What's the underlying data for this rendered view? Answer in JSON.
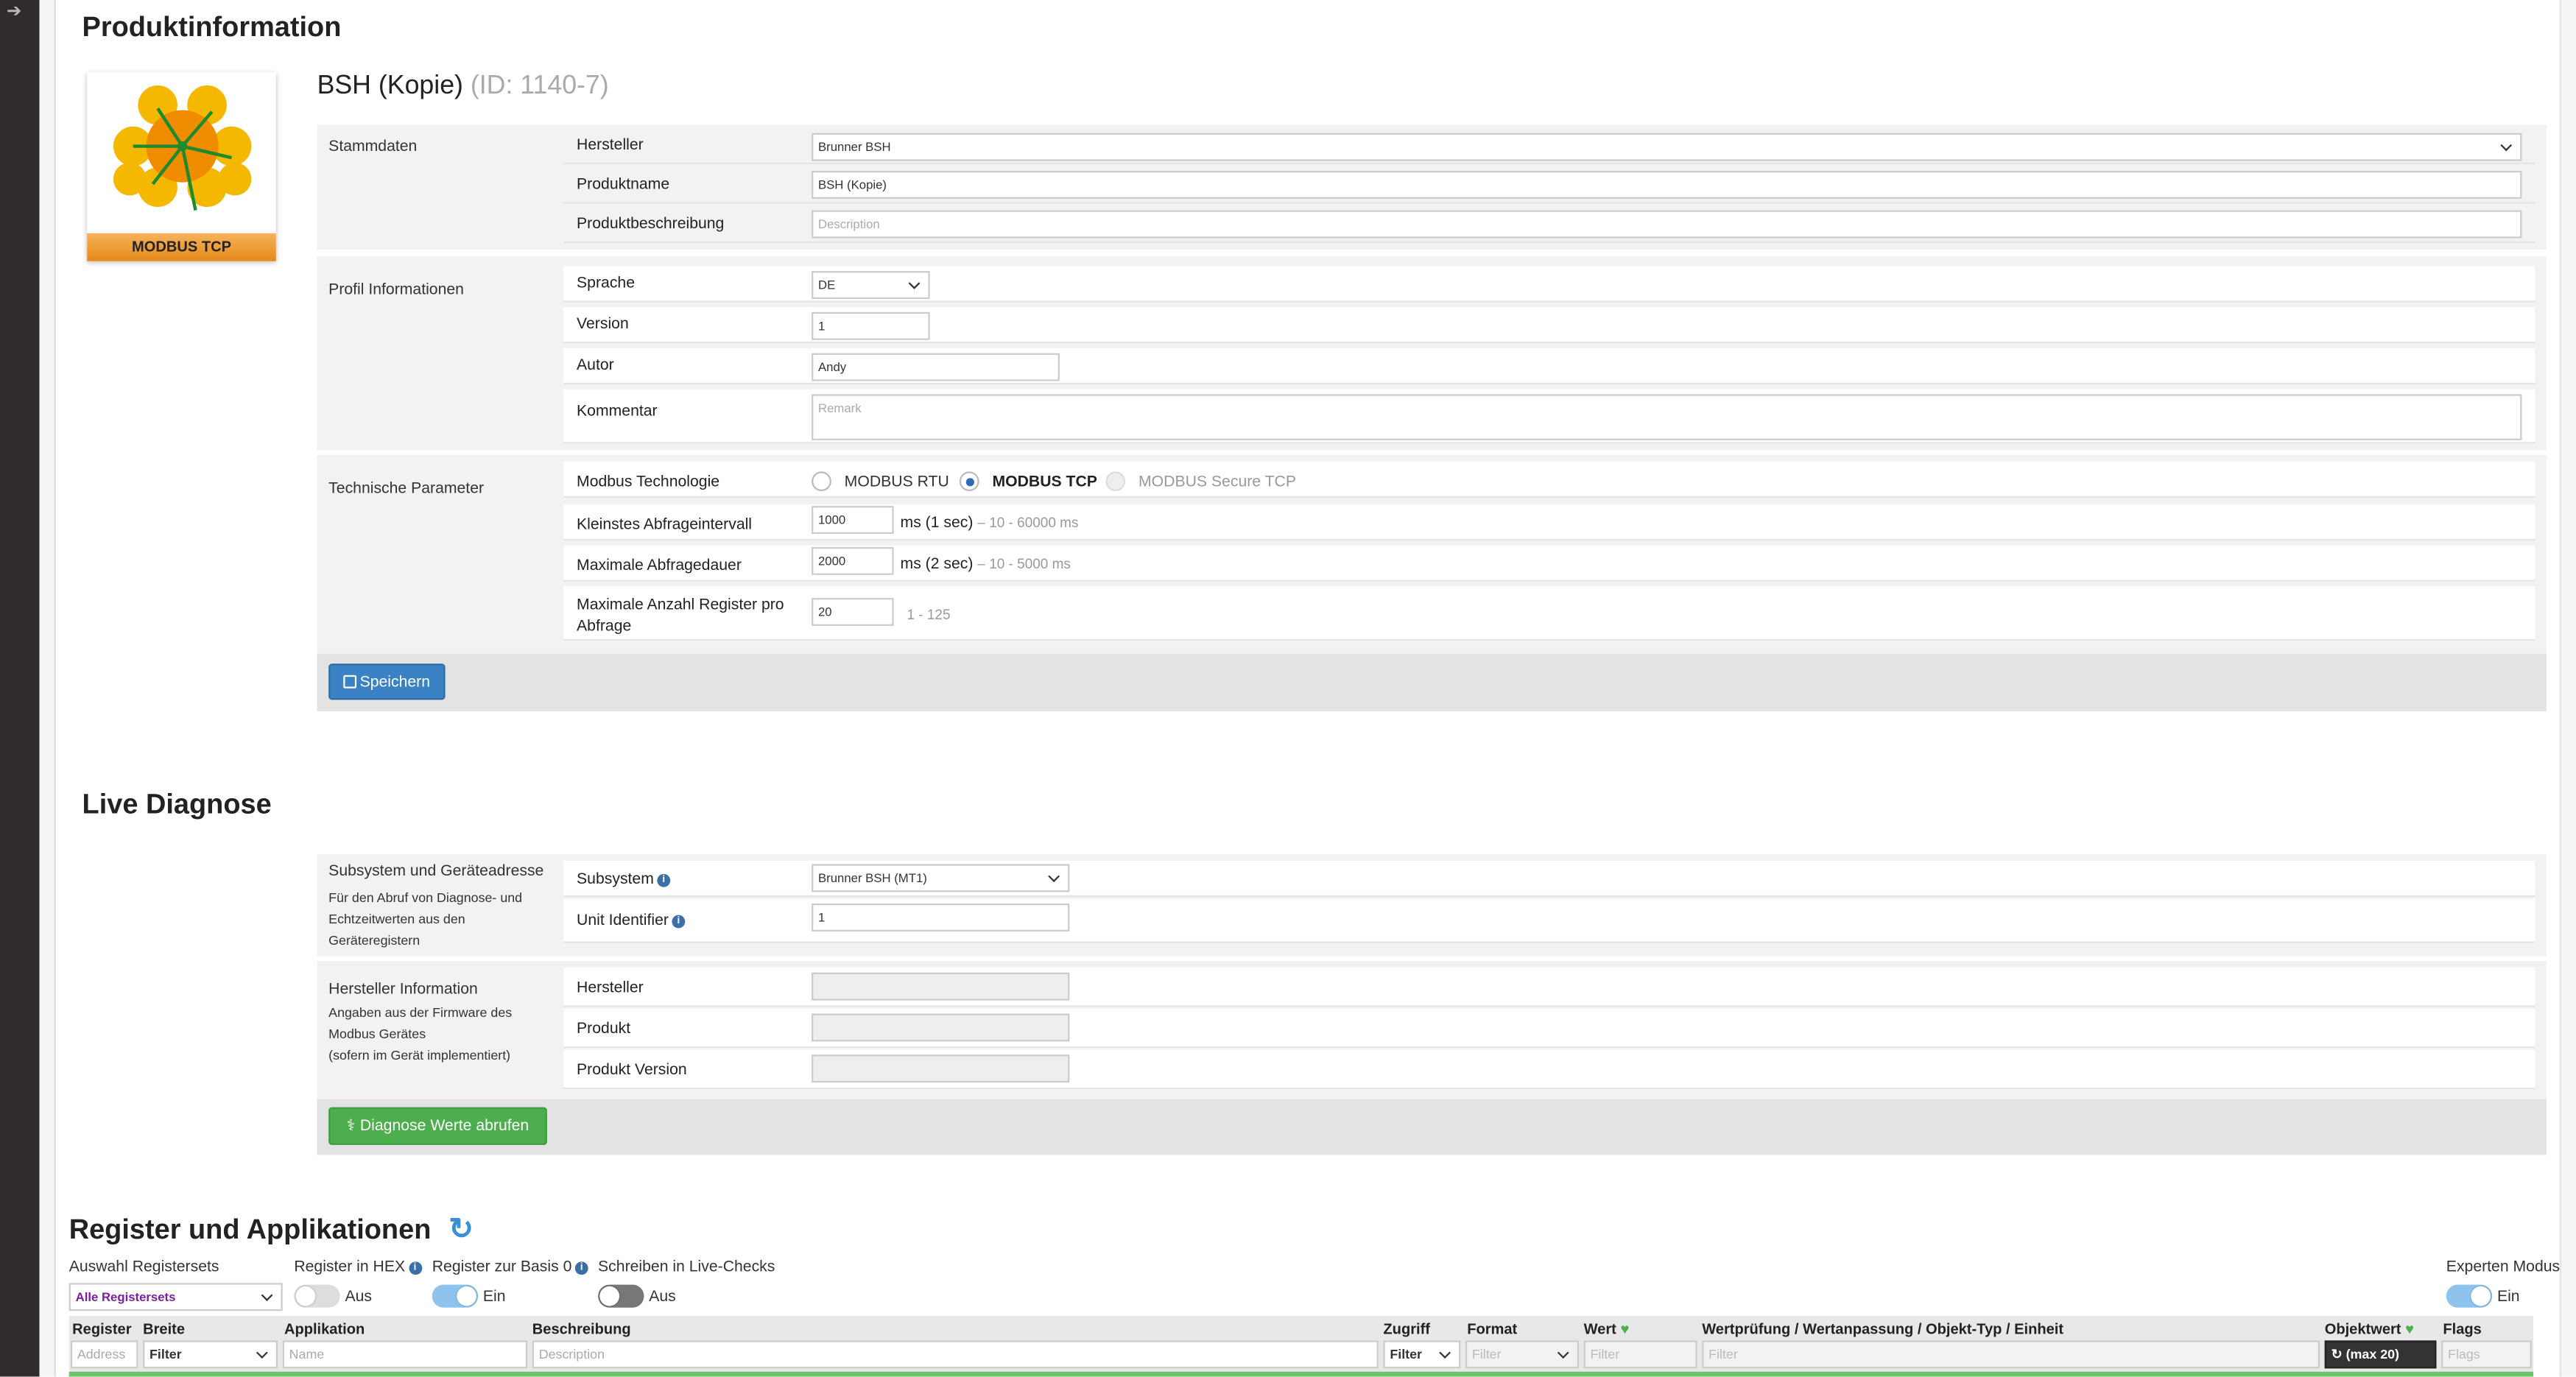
{
  "produktinfo": {
    "heading": "Produktinformation",
    "logo_label": "MODBUS TCP",
    "title": "BSH (Kopie)",
    "id_text": "(ID: 1140-7)",
    "stammdaten": {
      "label": "Stammdaten",
      "hersteller_label": "Hersteller",
      "hersteller_value": "Brunner BSH",
      "produktname_label": "Produktname",
      "produktname_value": "BSH (Kopie)",
      "beschreibung_label": "Produktbeschreibung",
      "beschreibung_placeholder": "Description"
    },
    "profil": {
      "label": "Profil Informationen",
      "sprache_label": "Sprache",
      "sprache_value": "DE",
      "version_label": "Version",
      "version_value": "1",
      "autor_label": "Autor",
      "autor_value": "Andy",
      "kommentar_label": "Kommentar",
      "kommentar_placeholder": "Remark"
    },
    "technik": {
      "label": "Technische Parameter",
      "modbus_label": "Modbus Technologie",
      "opt_rtu": "MODBUS RTU",
      "opt_tcp": "MODBUS TCP",
      "opt_secure": "MODBUS Secure TCP",
      "abfrageintervall_label": "Kleinstes Abfrageintervall",
      "abfrageintervall_value": "1000",
      "abfrageintervall_unit": "ms (1 sec)",
      "abfrageintervall_range": "– 10 - 60000 ms",
      "abfragedauer_label": "Maximale Abfragedauer",
      "abfragedauer_value": "2000",
      "abfragedauer_unit": "ms (2 sec)",
      "abfragedauer_range": "– 10 - 5000 ms",
      "maxreg_label_1": "Maximale Anzahl Register pro",
      "maxreg_label_2": "Abfrage",
      "maxreg_value": "20",
      "maxreg_range": "1 - 125"
    },
    "save_button": "Speichern"
  },
  "diagnose": {
    "heading": "Live Diagnose",
    "subsystem_group": {
      "label": "Subsystem und Geräteadresse",
      "desc_1": "Für den Abruf von Diagnose- und",
      "desc_2": "Echtzeitwerten aus den",
      "desc_3": "Geräteregistern",
      "subsystem_label": "Subsystem",
      "subsystem_value": "Brunner BSH (MT1)",
      "unit_label": "Unit Identifier",
      "unit_value": "1"
    },
    "hersteller_group": {
      "label": "Hersteller Information",
      "desc_1": "Angaben aus der Firmware des",
      "desc_2": "Modbus Gerätes",
      "desc_3": "(sofern im Gerät implementiert)",
      "hersteller_label": "Hersteller",
      "produkt_label": "Produkt",
      "version_label": "Produkt Version"
    },
    "button": "Diagnose Werte abrufen"
  },
  "register": {
    "heading": "Register und Applikationen",
    "auswahl_label": "Auswahl Registersets",
    "auswahl_value": "Alle Registersets",
    "hex_label": "Register in HEX",
    "hex_state": "Aus",
    "basis_label": "Register zur Basis 0",
    "basis_state": "Ein",
    "schreiben_label": "Schreiben in Live-Checks",
    "schreiben_state": "Aus",
    "experten_label": "Experten Modus",
    "experten_state": "Ein",
    "columns": {
      "register": "Register",
      "breite": "Breite",
      "applikation": "Applikation",
      "beschreibung": "Beschreibung",
      "zugriff": "Zugriff",
      "format": "Format",
      "wert": "Wert",
      "pruefung": "Wertprüfung / Wertanpassung / Objekt-Typ / Einheit",
      "objektwert": "Objektwert",
      "flags": "Flags"
    },
    "filters": {
      "address": "Address",
      "breite": "Filter",
      "name": "Name",
      "description": "Description",
      "zugriff": "Filter",
      "format": "Filter",
      "wert": "Filter",
      "pruefung": "Filter",
      "objektwert": "(max 20)",
      "flags": "Flags"
    }
  }
}
